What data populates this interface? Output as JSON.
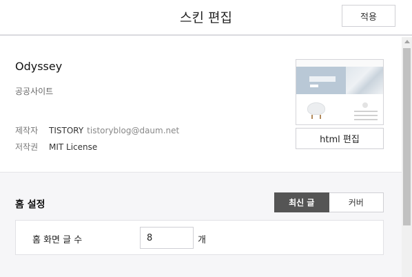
{
  "header": {
    "title": "스킨 편집",
    "apply_label": "적용"
  },
  "skin": {
    "name": "Odyssey",
    "description": "공공사이트",
    "maker_label": "제작자",
    "maker_name": "TISTORY",
    "maker_email": "tistoryblog@daum.net",
    "license_label": "저작권",
    "license_value": "MIT License",
    "html_edit_label": "html 편집"
  },
  "home": {
    "title": "홈 설정",
    "tabs": [
      "최신 글",
      "커버"
    ],
    "active_tab": "최신 글",
    "post_count_label": "홈 화면 글 수",
    "post_count_value": "8",
    "post_count_unit": "개"
  },
  "colors": {
    "active_tab_bg": "#555555",
    "section_bg": "#f6f6f8",
    "border": "#cfcfd4"
  }
}
